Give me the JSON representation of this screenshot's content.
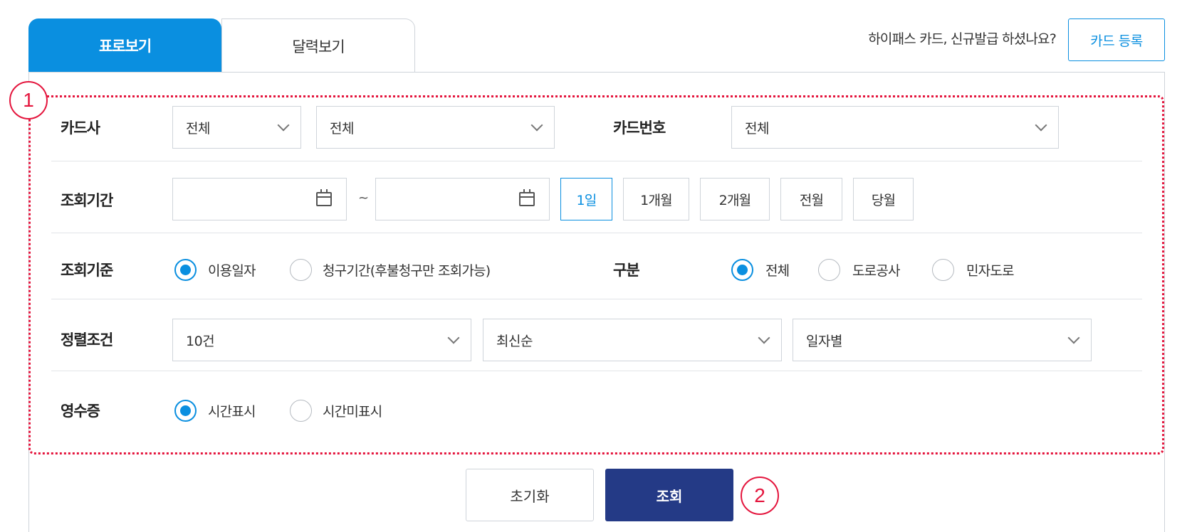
{
  "tabs": [
    {
      "label": "표로보기",
      "active": true
    },
    {
      "label": "달력보기",
      "active": false
    }
  ],
  "card_prompt": "하이패스 카드, 신규발급 하셨나요?",
  "card_register_label": "카드 등록",
  "markers": [
    "1",
    "2"
  ],
  "form": {
    "card_company": {
      "label": "카드사",
      "select1": "전체",
      "select2": "전체"
    },
    "card_number": {
      "label": "카드번호",
      "value": "전체"
    },
    "period": {
      "label": "조회기간",
      "start_value": "",
      "end_value": "",
      "separator": "~",
      "buttons": [
        "1일",
        "1개월",
        "2개월",
        "전월",
        "당월"
      ],
      "active_button": "1일"
    },
    "criteria": {
      "label": "조회기준",
      "options": [
        "이용일자",
        "청구기간(후불청구만 조회가능)"
      ],
      "selected": "이용일자"
    },
    "category": {
      "label": "구분",
      "options": [
        "전체",
        "도로공사",
        "민자도로"
      ],
      "selected": "전체"
    },
    "sort": {
      "label": "정렬조건",
      "count": "10건",
      "order": "최신순",
      "grouping": "일자별"
    },
    "receipt": {
      "label": "영수증",
      "options": [
        "시간표시",
        "시간미표시"
      ],
      "selected": "시간표시"
    }
  },
  "actions": {
    "reset_label": "초기화",
    "search_label": "조회"
  },
  "colors": {
    "accent": "#0a8fe0",
    "primary_button": "#243a86",
    "highlight_border": "#e4153d"
  }
}
